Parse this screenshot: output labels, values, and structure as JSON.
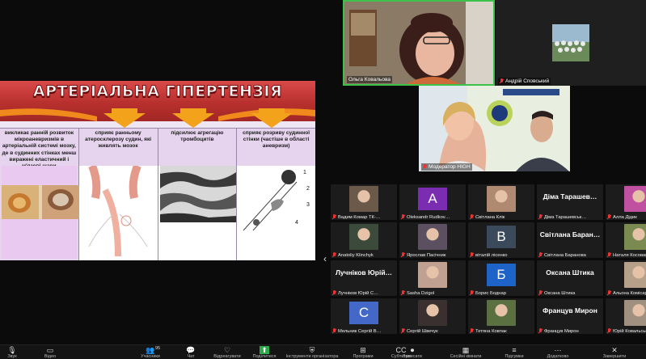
{
  "slide": {
    "title": "АРТЕРІАЛЬНА ГІПЕРТЕНЗІЯ",
    "columns": [
      {
        "text": "викликає ранній розвиток мікроаневризмів в артеріальній системі мозку, де в судинних стінках менш виражені еластичний і м'язові шари"
      },
      {
        "text": "сприяє ранньому атеросклерозу судин, які живлять мозок"
      },
      {
        "text": "підсилює агрегацію тромбоцитів"
      },
      {
        "text": "сприяє розриву судинної стінки (частіше в області аневризм)"
      }
    ],
    "figure_labels": [
      "1",
      "2",
      "3",
      "4"
    ]
  },
  "speakers": {
    "olga": "Ольга Ковальова",
    "andrii": "Андрій Сповський",
    "moderator": "Модератор HIGH"
  },
  "gallery": [
    {
      "name": "Вадим Комар ТК-…",
      "kind": "photo",
      "color": "#6b5a4a"
    },
    {
      "name": "Oleksandr Rudkov…",
      "kind": "letter",
      "letter": "A",
      "color": "#7a2db0"
    },
    {
      "name": "Світлана Клік",
      "kind": "photo",
      "color": "#b08a70"
    },
    {
      "name": "Діма Тарашевськ…",
      "kind": "bigname",
      "big": "Діма Тарашев…"
    },
    {
      "name": "Алла Дідик",
      "kind": "photo",
      "color": "#c050a0"
    },
    {
      "name": "Anatoliy Klinchyk",
      "kind": "photo",
      "color": "#3b4a3a"
    },
    {
      "name": "Ярослав Пасічник",
      "kind": "photo",
      "color": "#5a5060"
    },
    {
      "name": "віталій лісенко",
      "kind": "letter",
      "letter": "B",
      "color": "#3a4a5a"
    },
    {
      "name": "Світлана Баранова",
      "kind": "bigname",
      "big": "Світлана Баран…"
    },
    {
      "name": "Наталя Косован",
      "kind": "photo",
      "color": "#7a8a50"
    },
    {
      "name": "Лучніков Юрій С…",
      "kind": "bigname",
      "big": "Лучніков Юрій…"
    },
    {
      "name": "Sasha Dzigol",
      "kind": "photo",
      "color": "#c0a090"
    },
    {
      "name": "Борис Боднар",
      "kind": "letter",
      "letter": "Б",
      "color": "#1e63c8"
    },
    {
      "name": "Оксана Штика",
      "kind": "bigname",
      "big": "Оксана Штика"
    },
    {
      "name": "Альона Комісар",
      "kind": "photo",
      "color": "#b7a08a"
    },
    {
      "name": "Мельник Сергій В…",
      "kind": "letter",
      "letter": "C",
      "color": "#4468c8"
    },
    {
      "name": "Сергій Швечук",
      "kind": "photo",
      "color": "#3a3030"
    },
    {
      "name": "Тетяна Ковпак",
      "kind": "photo",
      "color": "#5a7040"
    },
    {
      "name": "Францув Мирон",
      "kind": "bigname",
      "big": "Францув Мирон"
    },
    {
      "name": "Юрій Ковальськ…",
      "kind": "photo",
      "color": "#a09080"
    }
  ],
  "toolbar": {
    "participants_count": "95",
    "items": [
      {
        "label": "Звук",
        "icon": "microphone-icon"
      },
      {
        "label": "Відео",
        "icon": "camera-icon"
      },
      {
        "label": "Учасники",
        "icon": "participants-icon"
      },
      {
        "label": "Чат",
        "icon": "chat-icon"
      },
      {
        "label": "Відреагувати",
        "icon": "heart-icon"
      },
      {
        "label": "Поділитися",
        "icon": "share-icon"
      },
      {
        "label": "Інструменти організатора",
        "icon": "shield-icon"
      },
      {
        "label": "Програми",
        "icon": "apps-icon"
      },
      {
        "label": "Субтитри",
        "icon": "cc-icon"
      },
      {
        "label": "Записати",
        "icon": "record-icon"
      },
      {
        "label": "Сесійні кімнати",
        "icon": "rooms-icon"
      },
      {
        "label": "Підсумки",
        "icon": "summary-icon"
      },
      {
        "label": "Додатково",
        "icon": "more-icon"
      },
      {
        "label": "Завершити",
        "icon": "end-icon"
      }
    ]
  }
}
